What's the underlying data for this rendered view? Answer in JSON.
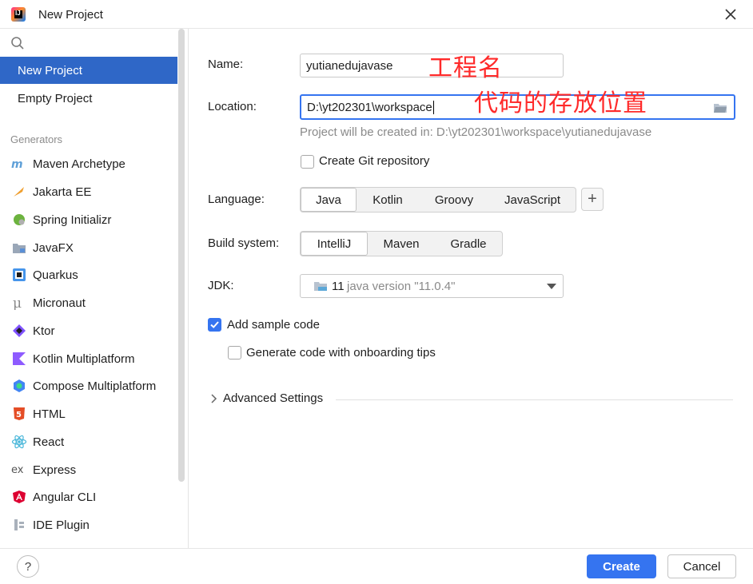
{
  "window": {
    "title": "New Project",
    "close_icon": "close-icon"
  },
  "sidebar": {
    "search_icon": "search-icon",
    "top_items": [
      {
        "label": "New Project",
        "selected": true
      },
      {
        "label": "Empty Project",
        "selected": false
      }
    ],
    "generators_header": "Generators",
    "generators": [
      {
        "label": "Maven Archetype",
        "icon": "maven-icon"
      },
      {
        "label": "Jakarta EE",
        "icon": "jakarta-ee-icon"
      },
      {
        "label": "Spring Initializr",
        "icon": "spring-icon"
      },
      {
        "label": "JavaFX",
        "icon": "javafx-icon"
      },
      {
        "label": "Quarkus",
        "icon": "quarkus-icon"
      },
      {
        "label": "Micronaut",
        "icon": "micronaut-icon"
      },
      {
        "label": "Ktor",
        "icon": "ktor-icon"
      },
      {
        "label": "Kotlin Multiplatform",
        "icon": "kotlin-icon"
      },
      {
        "label": "Compose Multiplatform",
        "icon": "compose-icon"
      },
      {
        "label": "HTML",
        "icon": "html5-icon"
      },
      {
        "label": "React",
        "icon": "react-icon"
      },
      {
        "label": "Express",
        "icon": "express-icon"
      },
      {
        "label": "Angular CLI",
        "icon": "angular-icon"
      },
      {
        "label": "IDE Plugin",
        "icon": "plugin-icon"
      }
    ]
  },
  "form": {
    "name_label": "Name:",
    "name_value": "yutianedujavase",
    "name_annotation": "工程名",
    "location_label": "Location:",
    "location_value": "D:\\yt202301\\workspace",
    "location_annotation": "代码的存放位置",
    "location_hint": "Project will be created in: D:\\yt202301\\workspace\\yutianedujavase",
    "git_label": "Create Git repository",
    "git_checked": false,
    "language_label": "Language:",
    "languages": [
      "Java",
      "Kotlin",
      "Groovy",
      "JavaScript"
    ],
    "language_selected": "Java",
    "add_language": "+",
    "build_label": "Build system:",
    "build_systems": [
      "IntelliJ",
      "Maven",
      "Gradle"
    ],
    "build_selected": "IntelliJ",
    "jdk_label": "JDK:",
    "jdk_version": "11",
    "jdk_name": "java version \"11.0.4\"",
    "sample_code_label": "Add sample code",
    "sample_code_checked": true,
    "onboarding_label": "Generate code with onboarding tips",
    "onboarding_checked": false,
    "advanced_label": "Advanced Settings"
  },
  "footer": {
    "help": "?",
    "create": "Create",
    "cancel": "Cancel"
  },
  "colors": {
    "accent": "#3574f0",
    "annotation": "#ff2a2a",
    "selected_row": "#2f67c7"
  }
}
